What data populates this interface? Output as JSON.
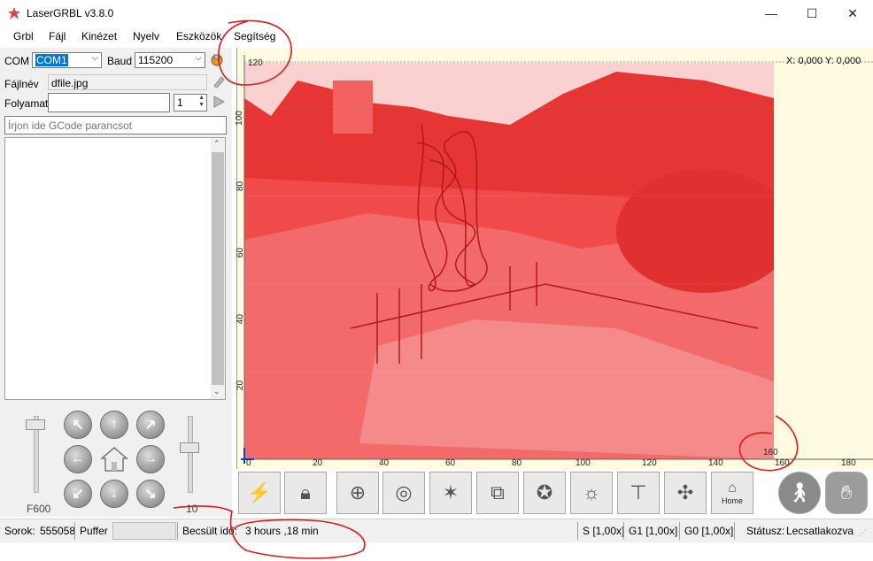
{
  "window": {
    "title": "LaserGRBL v3.8.0",
    "minimize_glyph": "—",
    "maximize_glyph": "☐",
    "close_glyph": "✕"
  },
  "menu": [
    "Grbl",
    "Fájl",
    "Kinézet",
    "Nyelv",
    "Eszközök",
    "Segítség"
  ],
  "connection": {
    "com_label": "COM",
    "com_value": "COM1",
    "baud_label": "Baud",
    "baud_value": "115200"
  },
  "file": {
    "label": "Fájlnév",
    "value": "dfile.jpg"
  },
  "progress": {
    "label": "Folyamat",
    "copies": "1"
  },
  "gcode_input": {
    "placeholder": "Írjon ide GCode parancsot"
  },
  "jog": {
    "speed_label": "F600",
    "step_label": "10",
    "home_icon": "home-icon"
  },
  "preview": {
    "coords": "X: 0,000 Y: 0,000",
    "x_ticks": [
      "0",
      "20",
      "40",
      "60",
      "80",
      "100",
      "120",
      "140",
      "160",
      "180"
    ],
    "y_ticks": [
      "20",
      "40",
      "60",
      "80",
      "100"
    ],
    "y_max_label": "120",
    "x_max_label": "160",
    "image_color": "#f04a4a"
  },
  "toolbar": {
    "home_label": "Home",
    "icons": [
      "lightning-icon",
      "lock-icon",
      "globe-pin-icon",
      "target-icon",
      "star-cursor-icon",
      "frame-icon",
      "star-circle-icon",
      "bulb-icon",
      "spindle-icon",
      "fan-icon",
      "home-button-icon",
      "walking-person-icon",
      "stop-hand-icon"
    ]
  },
  "status": {
    "lines_label": "Sorok:",
    "lines_value": "555058",
    "buffer_label": "Puffer",
    "estimate_label": "Becsült idő:",
    "estimate_value": "3 hours ,18 min",
    "s_override": "S [1,00x]",
    "g1_override": "G1 [1,00x]",
    "g0_override": "G0 [1,00x]",
    "status_label": "Státusz:",
    "status_value": "Lecsatlakozva"
  }
}
